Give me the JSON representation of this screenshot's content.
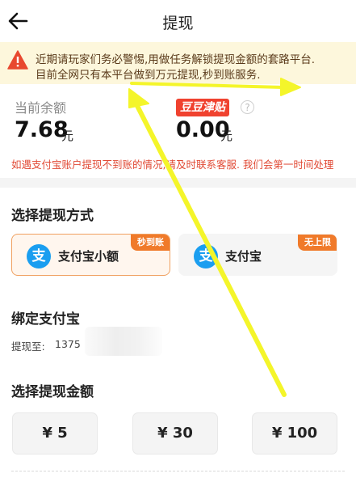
{
  "header": {
    "title": "提现",
    "back_icon": "arrow-left-icon"
  },
  "banner": {
    "icon": "warning-triangle-icon",
    "line1": "近期请玩家们务必警惕,用做任务解锁提现金额的套路平台.",
    "line2": "目前全网只有本平台做到万元提现,秒到账服务."
  },
  "balance": {
    "current_label": "当前余额",
    "current_value": "7.68",
    "current_unit": "元",
    "subsidy_badge": "豆豆津贴",
    "subsidy_help": "?",
    "subsidy_value": "0.00",
    "subsidy_unit": "元",
    "notice": "如遇支付宝账户提现不到账的情况,请及时联系客服. 我们会第一时间处理"
  },
  "method": {
    "title": "选择提现方式",
    "options": [
      {
        "label": "支付宝小额",
        "tag": "秒到账",
        "icon": "alipay-icon",
        "icon_glyph": "支",
        "selected": true
      },
      {
        "label": "支付宝",
        "tag": "无上限",
        "icon": "alipay-icon",
        "icon_glyph": "支",
        "selected": false
      }
    ]
  },
  "bind": {
    "title": "绑定支付宝",
    "label": "提现至:",
    "value": "1375"
  },
  "amount": {
    "title": "选择提现金额",
    "options": [
      "¥ 5",
      "¥ 30",
      "¥ 100"
    ]
  },
  "colors": {
    "accent_orange": "#f07a2a",
    "alert_red": "#e14a35",
    "badge_red": "#f0422f",
    "alipay_blue": "#1a9ef0",
    "banner_bg": "#fdf7dc",
    "annotation_yellow": "#f4f52a"
  }
}
